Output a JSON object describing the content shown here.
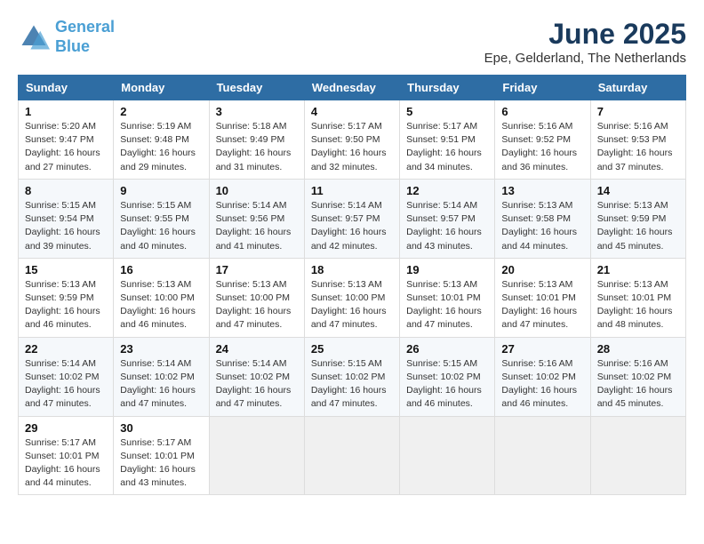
{
  "logo": {
    "line1": "General",
    "line2": "Blue"
  },
  "title": "June 2025",
  "subtitle": "Epe, Gelderland, The Netherlands",
  "weekdays": [
    "Sunday",
    "Monday",
    "Tuesday",
    "Wednesday",
    "Thursday",
    "Friday",
    "Saturday"
  ],
  "weeks": [
    [
      {
        "day": "1",
        "info": "Sunrise: 5:20 AM\nSunset: 9:47 PM\nDaylight: 16 hours\nand 27 minutes."
      },
      {
        "day": "2",
        "info": "Sunrise: 5:19 AM\nSunset: 9:48 PM\nDaylight: 16 hours\nand 29 minutes."
      },
      {
        "day": "3",
        "info": "Sunrise: 5:18 AM\nSunset: 9:49 PM\nDaylight: 16 hours\nand 31 minutes."
      },
      {
        "day": "4",
        "info": "Sunrise: 5:17 AM\nSunset: 9:50 PM\nDaylight: 16 hours\nand 32 minutes."
      },
      {
        "day": "5",
        "info": "Sunrise: 5:17 AM\nSunset: 9:51 PM\nDaylight: 16 hours\nand 34 minutes."
      },
      {
        "day": "6",
        "info": "Sunrise: 5:16 AM\nSunset: 9:52 PM\nDaylight: 16 hours\nand 36 minutes."
      },
      {
        "day": "7",
        "info": "Sunrise: 5:16 AM\nSunset: 9:53 PM\nDaylight: 16 hours\nand 37 minutes."
      }
    ],
    [
      {
        "day": "8",
        "info": "Sunrise: 5:15 AM\nSunset: 9:54 PM\nDaylight: 16 hours\nand 39 minutes."
      },
      {
        "day": "9",
        "info": "Sunrise: 5:15 AM\nSunset: 9:55 PM\nDaylight: 16 hours\nand 40 minutes."
      },
      {
        "day": "10",
        "info": "Sunrise: 5:14 AM\nSunset: 9:56 PM\nDaylight: 16 hours\nand 41 minutes."
      },
      {
        "day": "11",
        "info": "Sunrise: 5:14 AM\nSunset: 9:57 PM\nDaylight: 16 hours\nand 42 minutes."
      },
      {
        "day": "12",
        "info": "Sunrise: 5:14 AM\nSunset: 9:57 PM\nDaylight: 16 hours\nand 43 minutes."
      },
      {
        "day": "13",
        "info": "Sunrise: 5:13 AM\nSunset: 9:58 PM\nDaylight: 16 hours\nand 44 minutes."
      },
      {
        "day": "14",
        "info": "Sunrise: 5:13 AM\nSunset: 9:59 PM\nDaylight: 16 hours\nand 45 minutes."
      }
    ],
    [
      {
        "day": "15",
        "info": "Sunrise: 5:13 AM\nSunset: 9:59 PM\nDaylight: 16 hours\nand 46 minutes."
      },
      {
        "day": "16",
        "info": "Sunrise: 5:13 AM\nSunset: 10:00 PM\nDaylight: 16 hours\nand 46 minutes."
      },
      {
        "day": "17",
        "info": "Sunrise: 5:13 AM\nSunset: 10:00 PM\nDaylight: 16 hours\nand 47 minutes."
      },
      {
        "day": "18",
        "info": "Sunrise: 5:13 AM\nSunset: 10:00 PM\nDaylight: 16 hours\nand 47 minutes."
      },
      {
        "day": "19",
        "info": "Sunrise: 5:13 AM\nSunset: 10:01 PM\nDaylight: 16 hours\nand 47 minutes."
      },
      {
        "day": "20",
        "info": "Sunrise: 5:13 AM\nSunset: 10:01 PM\nDaylight: 16 hours\nand 47 minutes."
      },
      {
        "day": "21",
        "info": "Sunrise: 5:13 AM\nSunset: 10:01 PM\nDaylight: 16 hours\nand 48 minutes."
      }
    ],
    [
      {
        "day": "22",
        "info": "Sunrise: 5:14 AM\nSunset: 10:02 PM\nDaylight: 16 hours\nand 47 minutes."
      },
      {
        "day": "23",
        "info": "Sunrise: 5:14 AM\nSunset: 10:02 PM\nDaylight: 16 hours\nand 47 minutes."
      },
      {
        "day": "24",
        "info": "Sunrise: 5:14 AM\nSunset: 10:02 PM\nDaylight: 16 hours\nand 47 minutes."
      },
      {
        "day": "25",
        "info": "Sunrise: 5:15 AM\nSunset: 10:02 PM\nDaylight: 16 hours\nand 47 minutes."
      },
      {
        "day": "26",
        "info": "Sunrise: 5:15 AM\nSunset: 10:02 PM\nDaylight: 16 hours\nand 46 minutes."
      },
      {
        "day": "27",
        "info": "Sunrise: 5:16 AM\nSunset: 10:02 PM\nDaylight: 16 hours\nand 46 minutes."
      },
      {
        "day": "28",
        "info": "Sunrise: 5:16 AM\nSunset: 10:02 PM\nDaylight: 16 hours\nand 45 minutes."
      }
    ],
    [
      {
        "day": "29",
        "info": "Sunrise: 5:17 AM\nSunset: 10:01 PM\nDaylight: 16 hours\nand 44 minutes."
      },
      {
        "day": "30",
        "info": "Sunrise: 5:17 AM\nSunset: 10:01 PM\nDaylight: 16 hours\nand 43 minutes."
      },
      {
        "day": "",
        "info": ""
      },
      {
        "day": "",
        "info": ""
      },
      {
        "day": "",
        "info": ""
      },
      {
        "day": "",
        "info": ""
      },
      {
        "day": "",
        "info": ""
      }
    ]
  ]
}
